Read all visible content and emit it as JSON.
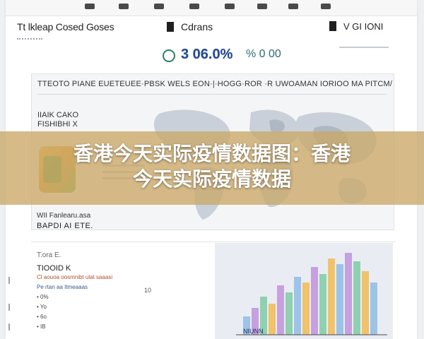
{
  "header": {
    "title": "Tt lkleap Cosed Goses",
    "middle": "Cdrans",
    "right": "V GI IONI"
  },
  "stats": {
    "primary": "3 06.0%",
    "secondary": "% 0 00"
  },
  "panel": {
    "headline": "TTEOTO PIANE EUETEUEE·PBSK WELS EON·|·HOGG·ROR ·R UWOAMAN IORIOO MA PITCM/",
    "block_label_1": "IIAIK CAKO",
    "block_label_2": "FISHIBHI X"
  },
  "lower": {
    "row1": "WII Fanlearu.asa",
    "row2": "BAPDI   AI  ETE.",
    "list_title": "T.ora   E.",
    "list_head": "TIOOID K",
    "items": [
      "Cl aouoa oosmnibt ulat saaasi",
      "Pe rtan aa Itmeaaas",
      "• 0%",
      "• Yo",
      "• 6o",
      "• IB"
    ],
    "side_mark": "10"
  },
  "chart_data": {
    "type": "bar",
    "categories": [],
    "series": [],
    "title": "",
    "xlabel": "",
    "ylabel": "",
    "caption": "NIUNN"
  },
  "banner": {
    "line1": "香港今天实际疫情数据图：香港",
    "line2": "今天实际疫情数据"
  },
  "colors": {
    "banner": "#cba868",
    "accent_blue": "#1b4aa8",
    "accent_green": "#2d7d6b"
  }
}
